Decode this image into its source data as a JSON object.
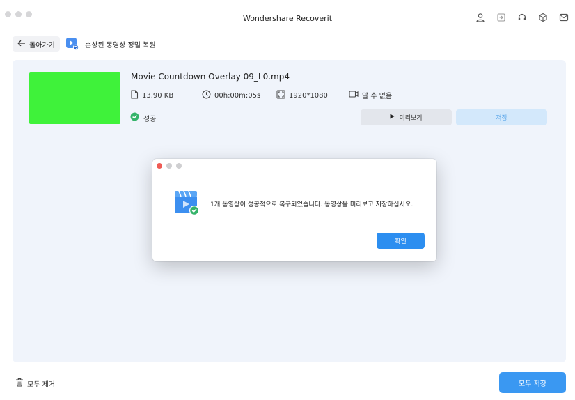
{
  "window": {
    "title": "Wondershare Recoverit"
  },
  "nav": {
    "back_label": "돌아가기",
    "breadcrumb_label": "손상된 동영상 정밀 복원"
  },
  "file": {
    "name": "Movie Countdown Overlay 09_L0.mp4",
    "size": "13.90 KB",
    "duration": "00h:00m:05s",
    "resolution": "1920*1080",
    "codec": "알 수 없음",
    "status": "성공",
    "thumbnail_color": "#3ff23a"
  },
  "actions": {
    "preview_label": "미리보기",
    "save_label": "저장"
  },
  "dialog": {
    "message": "1개 동영상이 성공적으로 복구되었습니다. 동영상을 미리보고 저장하십시오.",
    "ok_label": "확인"
  },
  "footer": {
    "remove_all_label": "모두 제거",
    "save_all_label": "모두 저장"
  },
  "colors": {
    "accent": "#2c8ef0",
    "success": "#35b36a",
    "panel": "#f0f4fb"
  }
}
